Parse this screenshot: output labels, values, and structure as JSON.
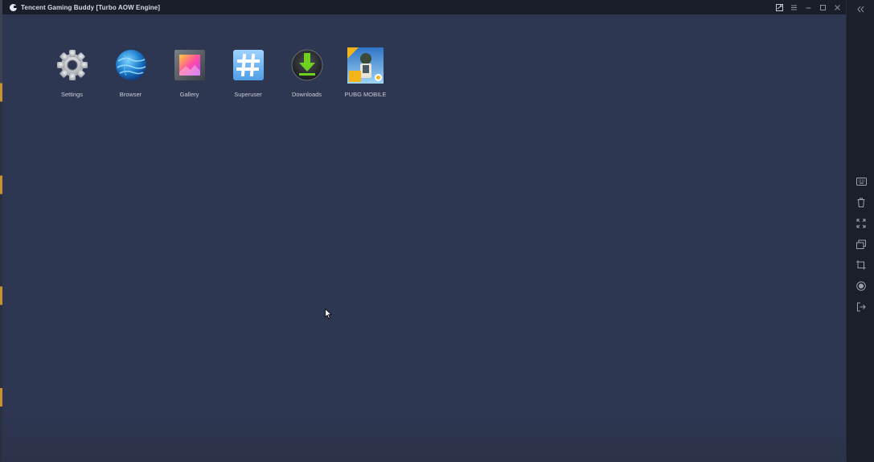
{
  "window": {
    "title": "Tencent Gaming Buddy  [Turbo AOW Engine]"
  },
  "colors": {
    "desktop_bg": "#2e3752",
    "titlebar_bg": "#1a1e2b",
    "sidebar_bg": "#1b1f2b",
    "label_text": "#c8ccd6"
  },
  "titlebar_controls": [
    {
      "icon": "screenshot-icon"
    },
    {
      "icon": "menu-icon"
    },
    {
      "icon": "minimize-icon"
    },
    {
      "icon": "maximize-icon"
    },
    {
      "icon": "close-icon"
    }
  ],
  "apps": [
    {
      "label": "Settings",
      "icon": "gear-icon"
    },
    {
      "label": "Browser",
      "icon": "globe-icon"
    },
    {
      "label": "Gallery",
      "icon": "gallery-icon"
    },
    {
      "label": "Superuser",
      "icon": "hash-icon"
    },
    {
      "label": "Downloads",
      "icon": "download-icon"
    },
    {
      "label": "PUBG MOBILE",
      "icon": "pubg-mobile-icon"
    }
  ],
  "sidebar": {
    "collapse_icon": "double-chevron-left-icon",
    "tools": [
      {
        "icon": "keyboard-icon"
      },
      {
        "icon": "trash-icon"
      },
      {
        "icon": "fullscreen-icon"
      },
      {
        "icon": "multi-window-icon"
      },
      {
        "icon": "crop-screenshot-icon"
      },
      {
        "icon": "record-icon"
      },
      {
        "icon": "exit-icon"
      }
    ]
  }
}
